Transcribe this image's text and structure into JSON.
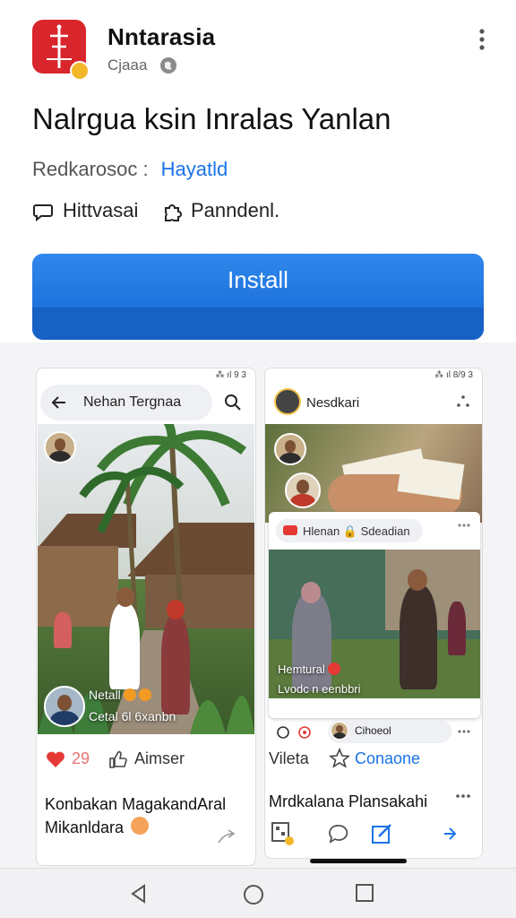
{
  "app": {
    "name": "Nntarasia",
    "developer": "Cjaaa",
    "title": "Nalrgua ksin Inralas Yanlan",
    "recommend_label": "Redkarosoc :",
    "recommend_value": "Hayatld",
    "feature_1": "Hittvasai",
    "feature_2": "Panndenl.",
    "install_label": "Install",
    "accent_color": "#1a73e8",
    "icon_color": "#d9252c"
  },
  "screenshot_1": {
    "status": "⁂ ıl 9 3",
    "search_query": "Nehan Tergnaa",
    "overlay_name": "Netall",
    "overlay_caption": "Cetal 6l 6xanbn",
    "reaction_count": "29",
    "action_label": "Aimser",
    "caption": "Konbakan MagakandAral Mikanldara"
  },
  "screenshot_2": {
    "status": "⁂ ıl 8/9 3",
    "poster": "Nesdkari",
    "chip_label": "Hlenan 🔒 Sdeadian",
    "overlay_title": "Hemtural",
    "overlay_sub": "Lvodc n eenbbri",
    "reaction_user": "Cihoeol",
    "action_left": "Vileta",
    "action_right": "Conaone",
    "caption": "Mrdkalana Plansakahi"
  },
  "icons": [
    "verify-badge",
    "globe-icon",
    "more-vert-icon",
    "chat-bubble-icon",
    "puzzle-icon",
    "back-arrow-icon",
    "search-icon",
    "heart-icon",
    "comment-icon",
    "star-icon",
    "share-icon",
    "back-nav-icon",
    "home-nav-icon",
    "recents-nav-icon"
  ]
}
